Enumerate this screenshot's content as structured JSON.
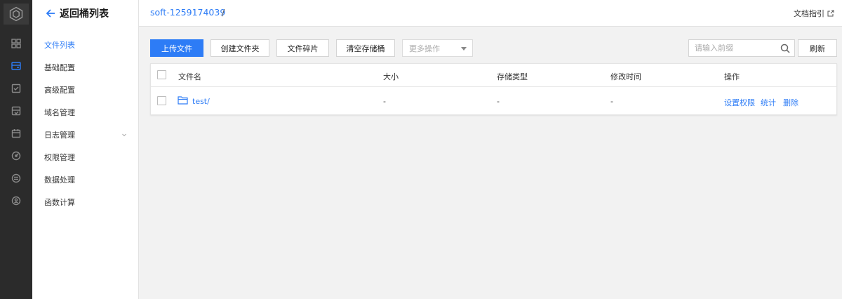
{
  "rail": {
    "icons": [
      "logo-icon",
      "dashboard-icon",
      "bucket-icon",
      "task-icon",
      "storage-check-icon",
      "calendar-icon",
      "monitor-icon",
      "cdn-icon",
      "user-icon"
    ]
  },
  "sidebar": {
    "back_label": "返回桶列表",
    "items": [
      {
        "label": "文件列表",
        "active": true
      },
      {
        "label": "基础配置"
      },
      {
        "label": "高级配置"
      },
      {
        "label": "域名管理"
      },
      {
        "label": "日志管理",
        "has_submenu": true
      },
      {
        "label": "权限管理"
      },
      {
        "label": "数据处理"
      },
      {
        "label": "函数计算"
      }
    ]
  },
  "header": {
    "bucket_name": "soft-1259174039",
    "separator": "/",
    "doc_link": "文档指引"
  },
  "toolbar": {
    "upload": "上传文件",
    "create_folder": "创建文件夹",
    "fragments": "文件碎片",
    "empty_bucket": "清空存储桶",
    "more_actions": "更多操作",
    "search_placeholder": "请输入前缀",
    "refresh": "刷新"
  },
  "table": {
    "columns": [
      "文件名",
      "大小",
      "存储类型",
      "修改时间",
      "操作"
    ],
    "rows": [
      {
        "name": "test/",
        "size": "-",
        "storage_class": "-",
        "modified": "-",
        "actions": [
          "设置权限",
          "统计",
          "删除"
        ]
      }
    ]
  },
  "colors": {
    "accent": "#2d7cf6",
    "rail": "#2b2b2b",
    "background": "#f2f2f2"
  }
}
